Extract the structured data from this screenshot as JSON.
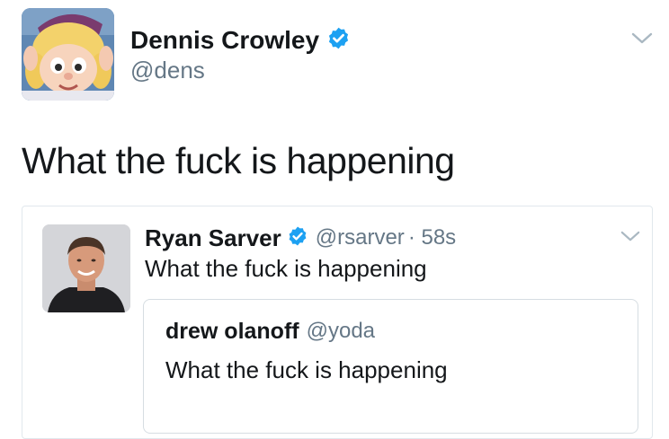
{
  "tweet": {
    "author_name": "Dennis Crowley",
    "author_handle": "@dens",
    "verified": true,
    "avatar_icon": "hermey-elf-avatar",
    "text": "What the fuck is happening",
    "menu_icon": "chevron-down-icon"
  },
  "retweet": {
    "author_name": "Ryan Sarver",
    "author_handle": "@rsarver",
    "time": "· 58s",
    "verified": true,
    "avatar_icon": "man-photo-avatar",
    "text": "What the fuck is happening",
    "menu_icon": "chevron-down-icon"
  },
  "quoted": {
    "author_name": "drew olanoff",
    "author_handle": "@yoda",
    "text": "What the fuck is happening"
  },
  "colors": {
    "verified_blue": "#1da1f2",
    "handle_gray": "#657786",
    "text_dark": "#14171a",
    "border": "#e1e8ed"
  }
}
